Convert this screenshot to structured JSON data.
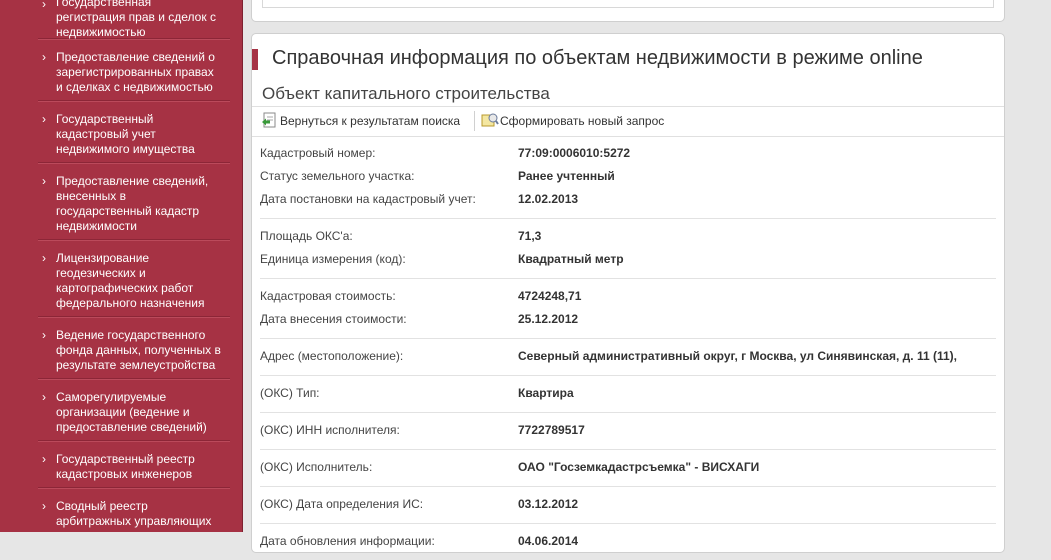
{
  "sidebar": {
    "items": [
      {
        "label": "Государственная регистрация прав и сделок с недвижимостью"
      },
      {
        "label": "Предоставление сведений о зарегистрированных правах и сделках с недвижимостью"
      },
      {
        "label": "Государственный кадастровый учет недвижимого имущества"
      },
      {
        "label": "Предоставление сведений, внесенных в государственный кадастр недвижимости"
      },
      {
        "label": "Лицензирование геодезических и картографических работ федерального назначения"
      },
      {
        "label": "Ведение государственного фонда данных, полученных в результате землеустройства"
      },
      {
        "label": "Саморегулируемые организации (ведение и предоставление сведений)"
      },
      {
        "label": "Государственный реестр кадастровых инженеров"
      },
      {
        "label": "Сводный реестр арбитражных управляющих"
      }
    ]
  },
  "main": {
    "title": "Справочная информация по объектам недвижимости в режиме online",
    "subtitle": "Объект капитального строительства",
    "toolbar": {
      "back_label": "Вернуться к результатам поиска",
      "new_label": "Сформировать новый запрос"
    },
    "groups": [
      {
        "rows": [
          {
            "key": "Кадастровый номер:",
            "value": "77:09:0006010:5272"
          },
          {
            "key": "Статус земельного участка:",
            "value": "Ранее учтенный"
          },
          {
            "key": "Дата постановки на кадастровый учет:",
            "value": "12.02.2013"
          }
        ]
      },
      {
        "rows": [
          {
            "key": "Площадь ОКС'а:",
            "value": "71,3"
          },
          {
            "key": "Единица измерения (код):",
            "value": "Квадратный метр"
          }
        ]
      },
      {
        "rows": [
          {
            "key": "Кадастровая стоимость:",
            "value": "4724248,71"
          },
          {
            "key": "Дата внесения стоимости:",
            "value": "25.12.2012"
          }
        ]
      },
      {
        "rows": [
          {
            "key": "Адрес (местоположение):",
            "value": "Северный административный округ, г Москва, ул Синявинская, д. 11 (11),"
          }
        ]
      },
      {
        "rows": [
          {
            "key": "(ОКС) Тип:",
            "value": "Квартира"
          }
        ]
      },
      {
        "rows": [
          {
            "key": "(ОКС) ИНН исполнителя:",
            "value": "7722789517"
          }
        ]
      },
      {
        "rows": [
          {
            "key": "(ОКС) Исполнитель:",
            "value": "ОАО \"Госземкадастрсъемка\" - ВИСХАГИ"
          }
        ]
      },
      {
        "rows": [
          {
            "key": "(ОКС) Дата определения ИС:",
            "value": "03.12.2012"
          }
        ]
      },
      {
        "rows": [
          {
            "key": "Дата обновления информации:",
            "value": "04.06.2014"
          }
        ]
      }
    ]
  },
  "colors": {
    "sidebar": "#a63244",
    "accent": "#a63244",
    "background": "#e6e6e6"
  }
}
